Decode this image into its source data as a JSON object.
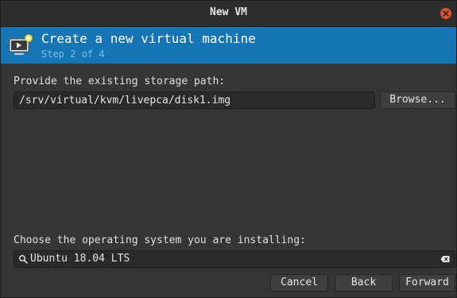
{
  "window": {
    "title": "New VM"
  },
  "header": {
    "title": "Create a new virtual machine",
    "step": "Step 2 of 4",
    "icon": "virtual-machine-icon"
  },
  "storage": {
    "label": "Provide the existing storage path:",
    "path_value": "/srv/virtual/kvm/livepca/disk1.img",
    "browse_label": "Browse..."
  },
  "os": {
    "label": "Choose the operating system you are installing:",
    "value": "Ubuntu 18.04 LTS"
  },
  "footer": {
    "cancel_label": "Cancel",
    "back_label": "Back",
    "forward_label": "Forward"
  },
  "colors": {
    "accent": "#1675b4",
    "window_bg": "#353535",
    "close": "#e2532f"
  }
}
